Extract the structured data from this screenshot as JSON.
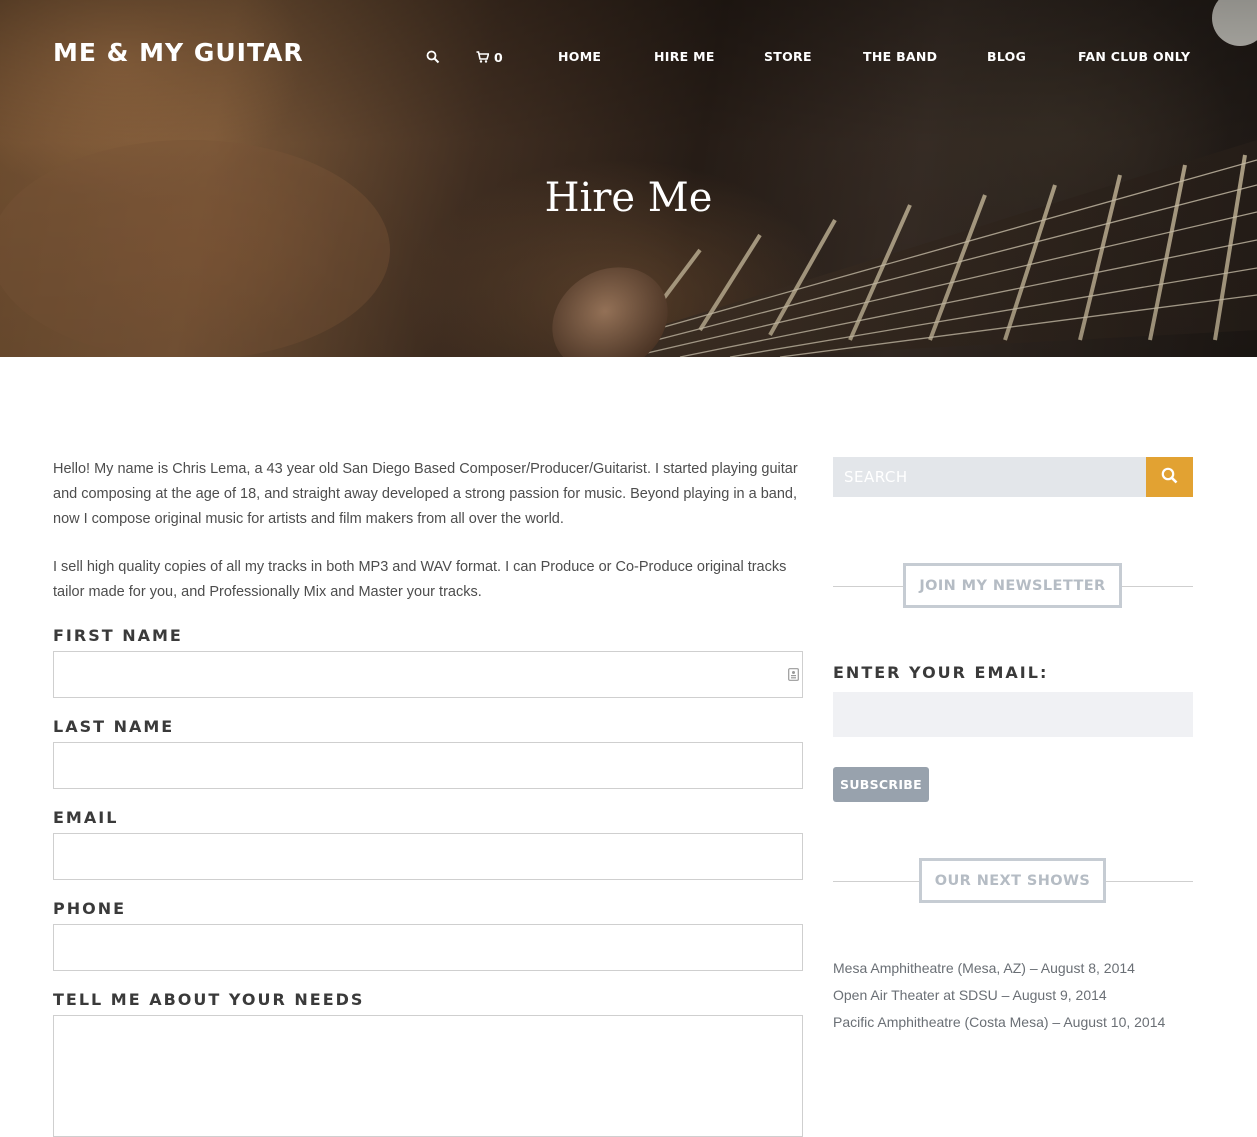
{
  "header": {
    "logo": "ME & MY GUITAR",
    "cart_count": "0",
    "nav": [
      {
        "label": "HOME"
      },
      {
        "label": "HIRE ME"
      },
      {
        "label": "STORE"
      },
      {
        "label": "THE BAND"
      },
      {
        "label": "BLOG"
      },
      {
        "label": "FAN CLUB ONLY"
      }
    ]
  },
  "hero": {
    "title": "Hire Me"
  },
  "main": {
    "paragraphs": [
      "Hello! My name is Chris Lema, a 43 year old San Diego Based Composer/Producer/Guitarist. I started playing guitar and composing at the age of 18, and straight away developed a strong passion for music. Beyond playing in a band, now I compose original music for artists and film makers from all over the world.",
      "I sell high quality copies of all my tracks in both MP3 and WAV format. I can Produce or Co-Produce original tracks tailor made for you, and Professionally Mix and Master your tracks."
    ],
    "form": {
      "first_name_label": "FIRST NAME",
      "last_name_label": "LAST NAME",
      "email_label": "EMAIL",
      "phone_label": "PHONE",
      "needs_label": "TELL ME ABOUT YOUR NEEDS"
    }
  },
  "sidebar": {
    "search_placeholder": "SEARCH",
    "newsletter": {
      "heading": "JOIN MY NEWSLETTER",
      "email_label": "ENTER YOUR EMAIL:",
      "subscribe_label": "SUBSCRIBE"
    },
    "shows": {
      "heading": "OUR NEXT SHOWS",
      "items": [
        "Mesa Amphitheatre (Mesa, AZ) – August 8, 2014",
        "Open Air Theater at SDSU – August 9, 2014",
        "Pacific Amphitheatre (Costa Mesa) – August 10, 2014"
      ]
    }
  },
  "colors": {
    "accent": "#e2a232",
    "subscribe_bg": "#98a2ad",
    "section_border": "#c6ccd3"
  },
  "icons": [
    "search-icon",
    "cart-icon",
    "autofill-icon"
  ]
}
